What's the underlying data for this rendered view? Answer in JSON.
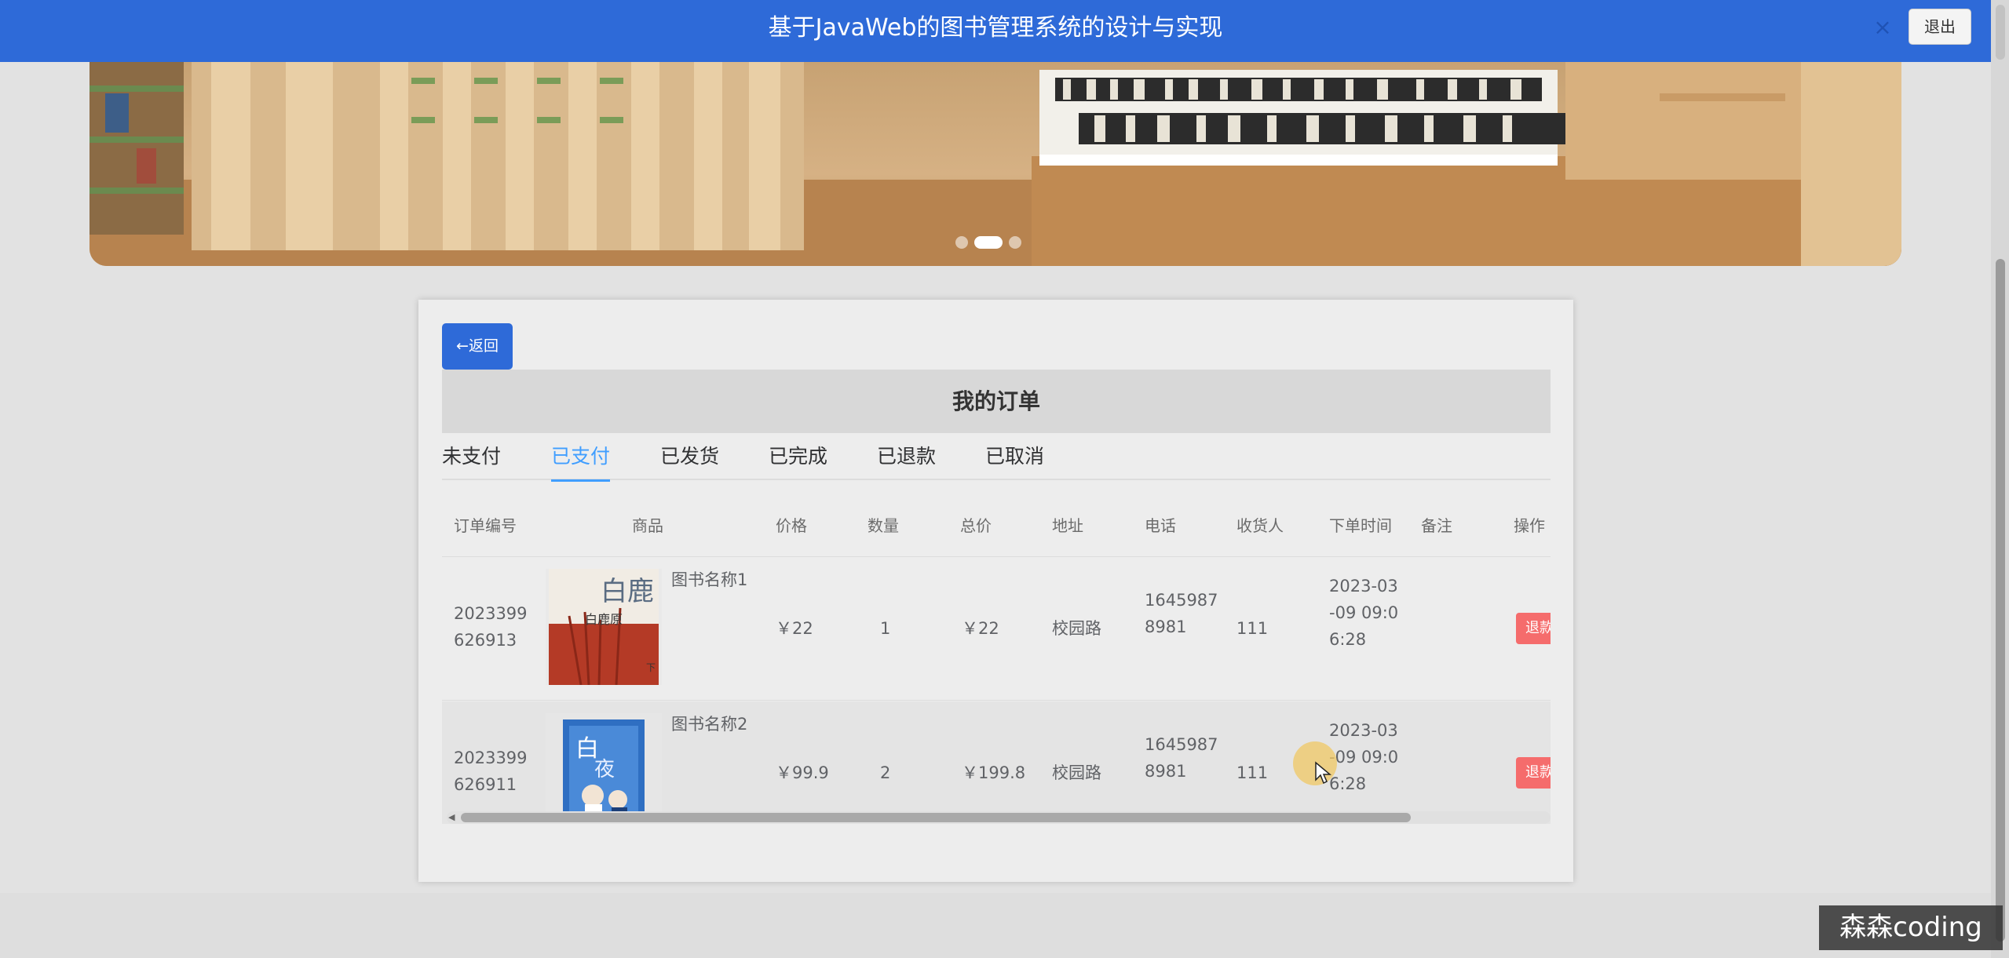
{
  "header": {
    "title": "基于JavaWeb的图书管理系统的设计与实现",
    "close_glyph": "×",
    "logout_label": "退出"
  },
  "banner": {
    "dots_count": 3,
    "active_dot": 1
  },
  "page": {
    "back_label": "←返回",
    "title": "我的订单"
  },
  "tabs": [
    {
      "label": "未支付",
      "active": false
    },
    {
      "label": "已支付",
      "active": true
    },
    {
      "label": "已发货",
      "active": false
    },
    {
      "label": "已完成",
      "active": false
    },
    {
      "label": "已退款",
      "active": false
    },
    {
      "label": "已取消",
      "active": false
    }
  ],
  "table": {
    "columns": [
      "订单编号",
      "商品",
      "价格",
      "数量",
      "总价",
      "地址",
      "电话",
      "收货人",
      "下单时间",
      "备注",
      "操作"
    ],
    "rows": [
      {
        "order_no_1": "2023399",
        "order_no_2": "626913",
        "product_name": "图书名称1",
        "price": "￥22",
        "qty": "1",
        "total": "￥22",
        "address": "校园路",
        "phone_1": "1645987",
        "phone_2": "8981",
        "receiver": "111",
        "time_1": "2023-03",
        "time_2": "-09 09:0",
        "time_3": "6:28",
        "remark": "",
        "action_label": "退款"
      },
      {
        "order_no_1": "2023399",
        "order_no_2": "626911",
        "product_name": "图书名称2",
        "price": "￥99.9",
        "qty": "2",
        "total": "￥199.8",
        "address": "校园路",
        "phone_1": "1645987",
        "phone_2": "8981",
        "receiver": "111",
        "time_1": "2023-03",
        "time_2": "-09 09:0",
        "time_3": "6:28",
        "remark": "",
        "action_label": "退款"
      }
    ]
  },
  "watermark": "森森coding",
  "colors": {
    "primary": "#2e6ad8",
    "tab_active": "#409eff",
    "danger": "#f56c6c"
  }
}
